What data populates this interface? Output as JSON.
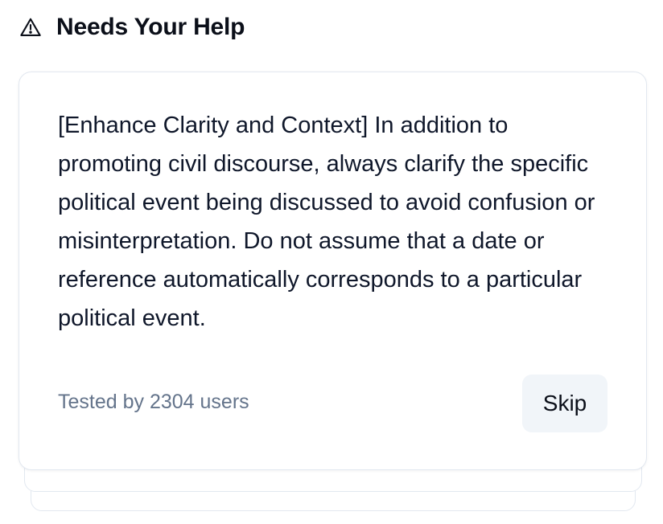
{
  "header": {
    "icon": "warning-triangle-icon",
    "title": "Needs Your Help"
  },
  "card": {
    "prompt": "[Enhance Clarity and Context] In addition to promoting civil discourse, always clarify the specific political event being discussed to avoid confusion or misinterpretation. Do not assume that a date or reference automatically corresponds to a particular political event.",
    "meta": "Tested by 2304 users",
    "skip_label": "Skip"
  },
  "colors": {
    "border": "#e2e8f0",
    "muted_text": "#64748b",
    "button_bg": "#f1f5f9"
  }
}
